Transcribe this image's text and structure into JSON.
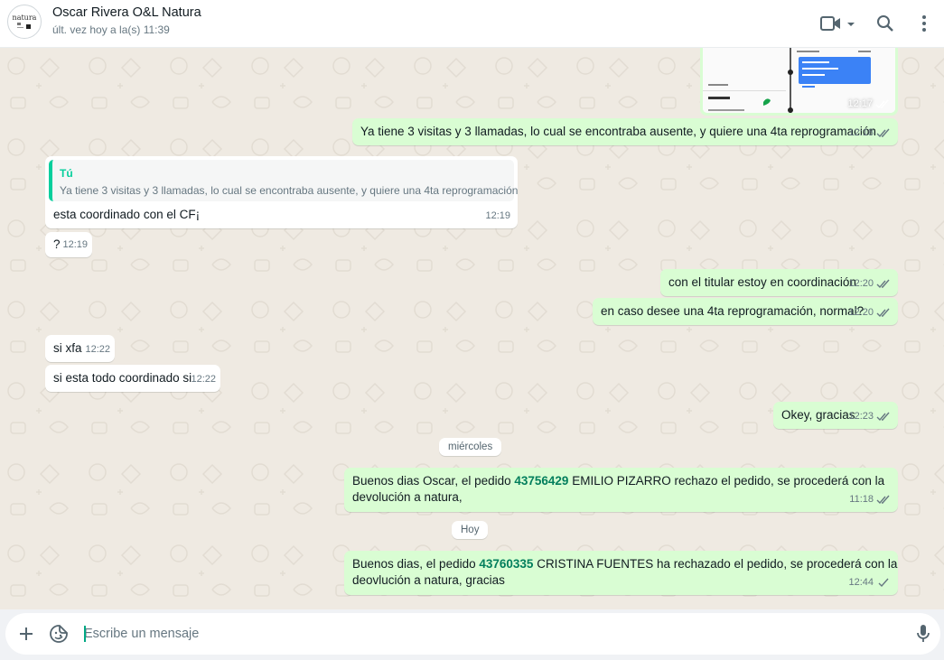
{
  "header": {
    "contact_name": "Oscar Rivera O&L Natura",
    "status": "últ. vez hoy a la(s) 11:39",
    "avatar_logo_text": "natura",
    "icons": [
      "video-call-icon",
      "search-icon",
      "menu-icon"
    ]
  },
  "colors": {
    "outgoing_bubble": "#d9fdd3",
    "incoming_bubble": "#ffffff",
    "chat_background": "#efeae2",
    "accent": "#00a884",
    "order_number": "#027e5c"
  },
  "messages": {
    "image_time": "12:17",
    "m1": {
      "text": "Ya tiene 3 visitas y 3 llamadas, lo cual se encontraba ausente, y quiere una 4ta reprogramación",
      "time": "12:18"
    },
    "m2": {
      "quote_author": "Tú",
      "quote_text": "Ya tiene 3 visitas y 3 llamadas, lo cual se encontraba ausente, y quiere una 4ta reprogramación",
      "text": "esta coordinado con el CF¡",
      "time": "12:19"
    },
    "m3": {
      "text": "?",
      "time": "12:19"
    },
    "m4": {
      "text": "con el titular estoy en coordinación",
      "time": "12:20"
    },
    "m5": {
      "text": "en caso desee una 4ta reprogramación, normal?",
      "time": "12:20"
    },
    "m6": {
      "text": "si xfa",
      "time": "12:22"
    },
    "m7": {
      "text": "si esta todo coordinado si",
      "time": "12:22"
    },
    "m8": {
      "text": "Okey, gracias",
      "time": "12:23"
    },
    "date1": "miércoles",
    "m9": {
      "pre": "Buenos dias Oscar, el pedido ",
      "order": "43756429",
      "post": " EMILIO PIZARRO rechazo el pedido, se procederá con la",
      "line2": "devolución a natura,",
      "time": "11:18"
    },
    "date2": "Hoy",
    "m10": {
      "pre": "Buenos dias, el pedido ",
      "order": "43760335",
      "post": " CRISTINA FUENTES ha rechazado el pedido, se procederá con la",
      "line2": "deovlución a natura, gracias",
      "time": "12:44"
    }
  },
  "composer": {
    "placeholder": "Escribe un mensaje",
    "icons": [
      "plus-icon",
      "sticker-icon",
      "microphone-icon"
    ]
  }
}
